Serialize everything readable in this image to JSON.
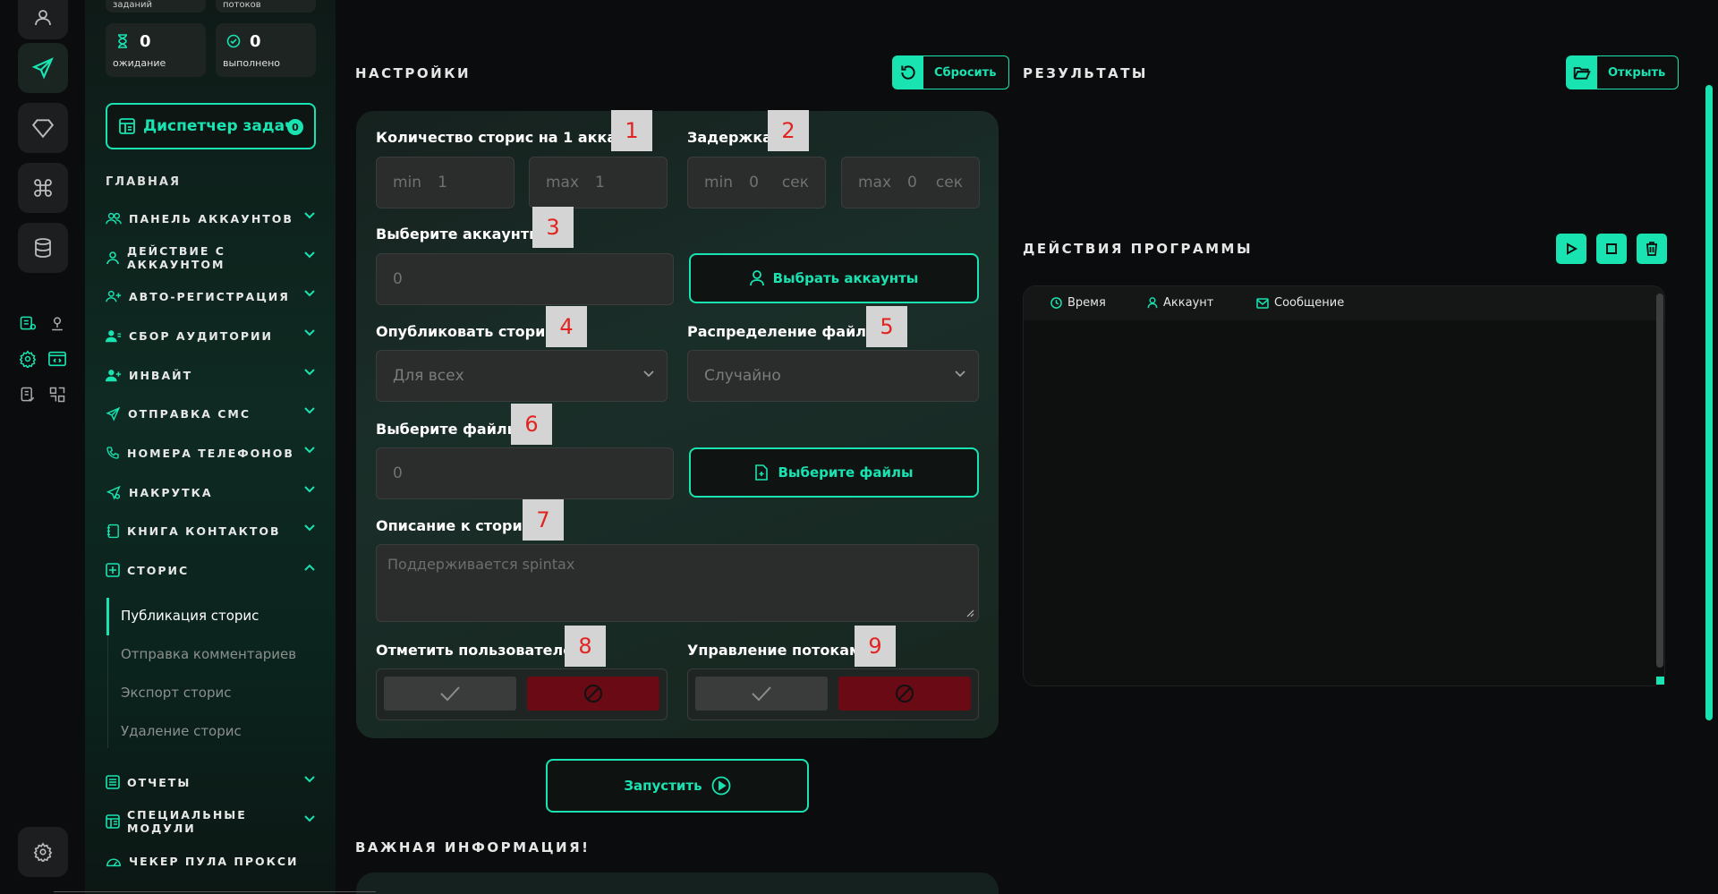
{
  "sidebar": {
    "stats_top": [
      {
        "label": "заданий"
      },
      {
        "label": "потоков"
      }
    ],
    "stats": [
      {
        "value": "0",
        "label": "ожидание",
        "icon": "hourglass-icon"
      },
      {
        "value": "0",
        "label": "выполнено",
        "icon": "check-circle-icon"
      }
    ],
    "dispatcher": {
      "label": "Диспетчер задач",
      "badge": "0"
    },
    "section_title": "ГЛАВНАЯ",
    "items": [
      {
        "label": "ПАНЕЛЬ АККАУНТОВ"
      },
      {
        "label": "ДЕЙСТВИЕ С АККАУНТОМ"
      },
      {
        "label": "АВТО-РЕГИСТРАЦИЯ"
      },
      {
        "label": "СБОР АУДИТОРИИ"
      },
      {
        "label": "ИНВАЙТ"
      },
      {
        "label": "ОТПРАВКА СМС"
      },
      {
        "label": "НОМЕРА ТЕЛЕФОНОВ"
      },
      {
        "label": "НАКРУТКА"
      },
      {
        "label": "КНИГА КОНТАКТОВ"
      },
      {
        "label": "СТОРИС"
      },
      {
        "label": "ОТЧЕТЫ"
      },
      {
        "label": "СПЕЦИАЛЬНЫЕ МОДУЛИ"
      },
      {
        "label": "ЧЕКЕР ПУЛА ПРОКСИ"
      }
    ],
    "stories_sub": [
      {
        "label": "Публикация сторис"
      },
      {
        "label": "Отправка комментариев"
      },
      {
        "label": "Экспорт сторис"
      },
      {
        "label": "Удаление сторис"
      }
    ]
  },
  "settings": {
    "title": "НАСТРОЙКИ",
    "reset_label": "Сбросить",
    "stories_count": {
      "label": "Количество сторис на 1 аккаунт",
      "tag": "1",
      "min_placeholder": "min",
      "min_value": "1",
      "max_placeholder": "max",
      "max_value": "1"
    },
    "delay": {
      "label": "Задержка",
      "tag": "2",
      "min_placeholder": "min",
      "min_value": "0",
      "max_placeholder": "max",
      "max_value": "0",
      "unit": "сек"
    },
    "accounts": {
      "label": "Выберите аккаунты",
      "tag": "3",
      "value": "0",
      "button": "Выбрать аккаунты"
    },
    "publish": {
      "label": "Опубликовать сторис",
      "tag": "4",
      "value": "Для всех"
    },
    "distribution": {
      "label": "Распределение файлов",
      "tag": "5",
      "value": "Случайно"
    },
    "files": {
      "label": "Выберите файлы",
      "tag": "6",
      "value": "0",
      "button": "Выберите файлы"
    },
    "description": {
      "label": "Описание к сторис",
      "tag": "7",
      "placeholder": "Поддерживается spintax"
    },
    "mark_users": {
      "label": "Отметить пользователей",
      "tag": "8"
    },
    "threads": {
      "label": "Управление потоками",
      "tag": "9"
    },
    "launch_label": "Запустить"
  },
  "important_title": "ВАЖНАЯ ИНФОРМАЦИЯ!",
  "results": {
    "title": "РЕЗУЛЬТАТЫ",
    "open_label": "Открыть"
  },
  "actions": {
    "title": "ДЕЙСТВИЯ ПРОГРАММЫ",
    "columns": [
      {
        "label": "Время",
        "icon": "clock-icon"
      },
      {
        "label": "Аккаунт",
        "icon": "user-icon"
      },
      {
        "label": "Сообщение",
        "icon": "mail-icon"
      }
    ]
  },
  "colors": {
    "accent": "#19e3b1",
    "danger": "#6a0a14",
    "tag_text": "#e3231f"
  }
}
